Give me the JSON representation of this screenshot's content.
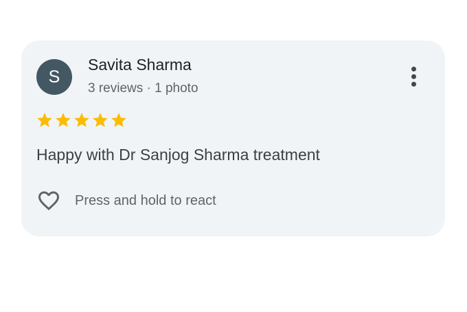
{
  "review": {
    "avatar_letter": "S",
    "avatar_color": "#445864",
    "reviewer_name": "Savita Sharma",
    "reviewer_meta": "3 reviews · 1 photo",
    "rating": 5,
    "rating_max": 5,
    "star_color": "#fbbc04",
    "text": "Happy with Dr Sanjog Sharma treatment",
    "react_label": "Press and hold to react",
    "more_icon": "more-vert-icon",
    "react_icon": "heart-outline-icon"
  }
}
